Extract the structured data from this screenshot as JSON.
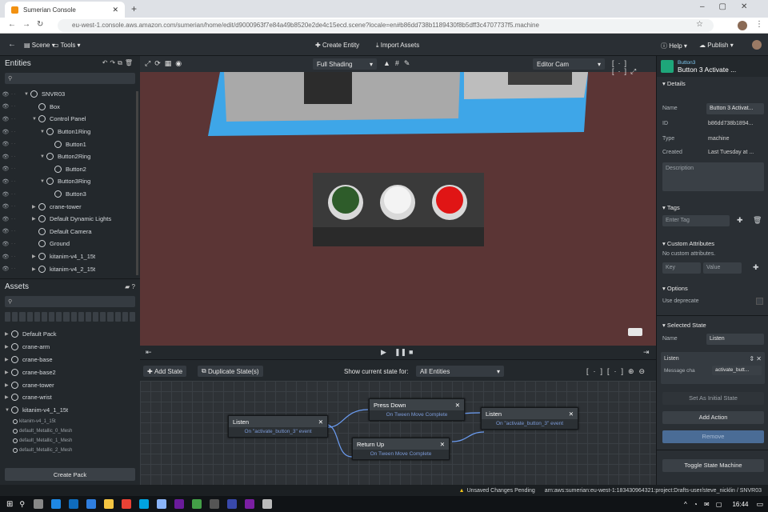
{
  "browser": {
    "tab_title": "Sumerian Console",
    "url": "eu-west-1.console.aws.amazon.com/sumerian/home/edit/d9000963f7e84a49b8520e2de4c15ecd.scene?locale=en#b86dd738b1189430f8b5dff3c4707737f5.machine"
  },
  "toolbar": {
    "scene": "Scene",
    "tools": "Tools",
    "create_entity": "Create Entity",
    "import_assets": "Import Assets",
    "help": "Help",
    "publish": "Publish"
  },
  "entities": {
    "title": "Entities",
    "items": [
      {
        "label": "SNVR03",
        "depth": 0,
        "expanded": true
      },
      {
        "label": "Box",
        "depth": 1,
        "expanded": null
      },
      {
        "label": "Control Panel",
        "depth": 1,
        "expanded": true
      },
      {
        "label": "Button1Ring",
        "depth": 2,
        "expanded": true
      },
      {
        "label": "Button1",
        "depth": 3,
        "expanded": null
      },
      {
        "label": "Button2Ring",
        "depth": 2,
        "expanded": true
      },
      {
        "label": "Button2",
        "depth": 3,
        "expanded": null
      },
      {
        "label": "Button3Ring",
        "depth": 2,
        "expanded": true
      },
      {
        "label": "Button3",
        "depth": 3,
        "expanded": null
      },
      {
        "label": "crane-tower",
        "depth": 1,
        "expanded": false
      },
      {
        "label": "Default Dynamic Lights",
        "depth": 1,
        "expanded": false
      },
      {
        "label": "Default Camera",
        "depth": 1,
        "expanded": null
      },
      {
        "label": "Ground",
        "depth": 1,
        "expanded": null
      },
      {
        "label": "kitanim-v4_1_15t",
        "depth": 1,
        "expanded": false
      },
      {
        "label": "kitanim-v4_2_15t",
        "depth": 1,
        "expanded": false
      }
    ]
  },
  "assets": {
    "title": "Assets",
    "items": [
      {
        "label": "Default Pack",
        "depth": 0
      },
      {
        "label": "crane-arm",
        "depth": 0
      },
      {
        "label": "crane-base",
        "depth": 0
      },
      {
        "label": "crane-base2",
        "depth": 0
      },
      {
        "label": "crane-tower",
        "depth": 0
      },
      {
        "label": "crane-wrist",
        "depth": 0
      },
      {
        "label": "kitanim-v4_1_15t",
        "depth": 0
      },
      {
        "label": "kitanim-v4_1_15t",
        "depth": 1
      },
      {
        "label": "default_Metallic_0_Mesh",
        "depth": 1
      },
      {
        "label": "default_Metallic_1_Mesh",
        "depth": 1
      },
      {
        "label": "default_Metallic_2_Mesh",
        "depth": 1
      }
    ],
    "create_pack": "Create Pack"
  },
  "viewport": {
    "shading": "Full Shading",
    "camera": "Editor Cam"
  },
  "state_machine": {
    "add_state": "Add State",
    "duplicate_state": "Duplicate State(s)",
    "show_label": "Show current state for:",
    "show_value": "All Entities",
    "states": [
      {
        "title": "Listen",
        "event": "On \"activate_button_3\" event"
      },
      {
        "title": "Press Down",
        "event": "On Tween Move Complete"
      },
      {
        "title": "Listen",
        "event": "On \"activate_button_3\" event"
      },
      {
        "title": "Return Up",
        "event": "On Tween Move Complete"
      }
    ]
  },
  "inspector": {
    "kind": "Button3",
    "title": "Button 3 Activate ...",
    "details": "Details",
    "name_label": "Name",
    "name_value": "Button 3 Activat...",
    "id_label": "ID",
    "id_value": "b86dd738b1894...",
    "type_label": "Type",
    "type_value": "machine",
    "created_label": "Created",
    "created_value": "Last Tuesday at ...",
    "description_placeholder": "Description",
    "tags": "Tags",
    "tag_placeholder": "Enter Tag",
    "custom_attributes": "Custom Attributes",
    "no_custom": "No custom attributes.",
    "key_placeholder": "Key",
    "value_placeholder": "Value",
    "options": "Options",
    "use_deprecated": "Use deprecate",
    "selected_state": "Selected State",
    "state_name_label": "Name",
    "state_name_value": "Listen",
    "action_name": "Listen",
    "message_label": "Message cha",
    "message_value": "activate_butt...",
    "set_initial": "Set As Initial State",
    "add_action": "Add Action",
    "remove": "Remove",
    "toggle": "Toggle State Machine"
  },
  "status": {
    "unsaved": "Unsaved Changes Pending",
    "path": "arn:aws:sumerian:eu-west-1:183430964321:project:Drafts-user/steve_nicklin / SNVR03"
  },
  "taskbar": {
    "time": "16:44"
  }
}
